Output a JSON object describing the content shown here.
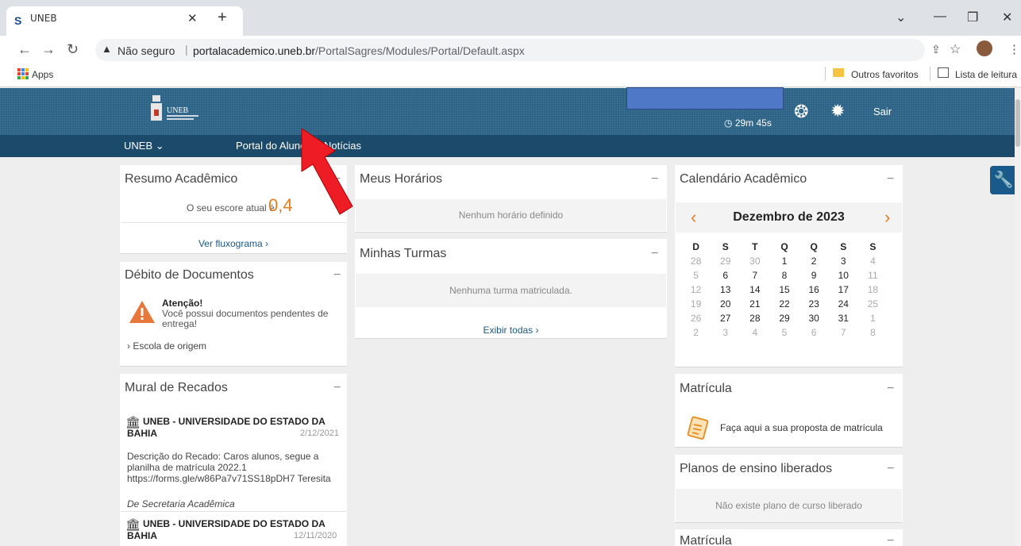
{
  "browser": {
    "tab_title": "UNEB",
    "tab_favicon": "S",
    "url_warning": "Não seguro",
    "url_separator": "|",
    "url_host": "portalacademico.uneb.br",
    "url_path": "/PortalSagres/Modules/Portal/Default.aspx",
    "bookmark_apps": "Apps",
    "bookmark_other": "Outros favoritos",
    "bookmark_reading": "Lista de leitura"
  },
  "header": {
    "timer": "29m 45s",
    "logout": "Sair",
    "logo_text": "UNEB"
  },
  "nav": {
    "items": [
      {
        "label": "UNEB ⌄"
      },
      {
        "label": "Portal do Aluno"
      },
      {
        "label": "Notícias"
      }
    ]
  },
  "resumo": {
    "title": "Resumo Acadêmico",
    "score_text": "O seu escore atual é",
    "score_value": "0,4",
    "link": "Ver fluxograma ›"
  },
  "debito": {
    "title": "Débito de Documentos",
    "alert_title": "Atenção!",
    "alert_text": "Você possui documentos pendentes de entrega!",
    "link": "› Escola de origem"
  },
  "mural": {
    "title": "Mural de Recados",
    "posts": [
      {
        "org": "UNEB - UNIVERSIDADE DO ESTADO DA BAHIA",
        "date": "2/12/2021",
        "body": "Descrição do Recado: Caros alunos, segue a planilha de matrícula 2022.1 https://forms.gle/w86Pa7v71SS18pDH7 Teresita",
        "from": "De Secretaria Acadêmica"
      },
      {
        "org": "UNEB - UNIVERSIDADE DO ESTADO DA BAHIA",
        "date": "12/11/2020"
      }
    ]
  },
  "horarios": {
    "title": "Meus Horários",
    "empty": "Nenhum horário definido"
  },
  "turmas": {
    "title": "Minhas Turmas",
    "empty": "Nenhuma turma matriculada.",
    "link": "Exibir todas ›"
  },
  "calendario": {
    "title": "Calendário Acadêmico",
    "month": "Dezembro de 2023",
    "prev": "‹",
    "next": "›",
    "weekdays": [
      "D",
      "S",
      "T",
      "Q",
      "Q",
      "S",
      "S"
    ],
    "weeks": [
      [
        "28",
        "29",
        "30",
        "1",
        "2",
        "3",
        "4"
      ],
      [
        "5",
        "6",
        "7",
        "8",
        "9",
        "10",
        "11"
      ],
      [
        "12",
        "13",
        "14",
        "15",
        "16",
        "17",
        "18"
      ],
      [
        "19",
        "20",
        "21",
        "22",
        "23",
        "24",
        "25"
      ],
      [
        "26",
        "27",
        "28",
        "29",
        "30",
        "31",
        "1"
      ],
      [
        "2",
        "3",
        "4",
        "5",
        "6",
        "7",
        "8"
      ]
    ]
  },
  "matricula": {
    "title": "Matrícula",
    "text": "Faça aqui a sua proposta de matrícula"
  },
  "planos": {
    "title": "Planos de ensino liberados",
    "empty": "Não existe plano de curso liberado"
  },
  "matricula2": {
    "title": "Matrícula"
  },
  "minus": "−"
}
